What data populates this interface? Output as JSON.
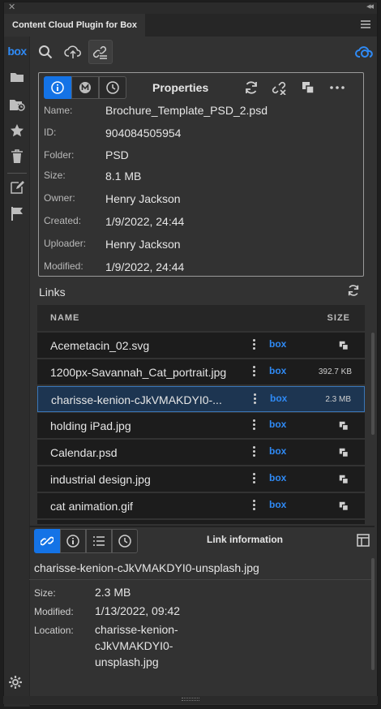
{
  "window": {
    "tab_title": "Content Cloud Plugin for Box"
  },
  "rail": {
    "logo": "box"
  },
  "properties": {
    "title": "Properties",
    "fields": [
      {
        "label": "Name:",
        "value": "Brochure_Template_PSD_2.psd"
      },
      {
        "label": "ID:",
        "value": "904084505954"
      },
      {
        "label": "Folder:",
        "value": "PSD"
      },
      {
        "label": "Size:",
        "value": "8.1 MB"
      },
      {
        "label": "Owner:",
        "value": "Henry Jackson"
      },
      {
        "label": "Created:",
        "value": "1/9/2022, 24:44"
      },
      {
        "label": "Uploader:",
        "value": "Henry Jackson"
      },
      {
        "label": "Modified:",
        "value": "1/9/2022, 24:44"
      }
    ]
  },
  "links": {
    "heading": "Links",
    "col_name": "NAME",
    "col_size": "SIZE",
    "box_label": "box",
    "rows": [
      {
        "name": "Acemetacin_02.svg",
        "size": ""
      },
      {
        "name": "1200px-Savannah_Cat_portrait.jpg",
        "size": "392.7 KB"
      },
      {
        "name": "charisse-kenion-cJkVMAKDYI0-...",
        "size": "2.3 MB"
      },
      {
        "name": "holding iPad.jpg",
        "size": ""
      },
      {
        "name": "Calendar.psd",
        "size": ""
      },
      {
        "name": "industrial design.jpg",
        "size": ""
      },
      {
        "name": "cat animation.gif",
        "size": ""
      },
      {
        "name": "",
        "size": ""
      }
    ]
  },
  "link_info": {
    "title": "Link information",
    "file": "charisse-kenion-cJkVMAKDYI0-unsplash.jpg",
    "size_label": "Size:",
    "size": "2.3 MB",
    "modified_label": "Modified:",
    "modified": "1/13/2022, 09:42",
    "location_label": "Location:",
    "location_lines": [
      "charisse-kenion-",
      "cJkVMAKDYI0-",
      "unsplash.jpg"
    ]
  },
  "colors": {
    "accent": "#1473e6",
    "box_blue": "#2f8af5",
    "selection": "#1d3551"
  }
}
